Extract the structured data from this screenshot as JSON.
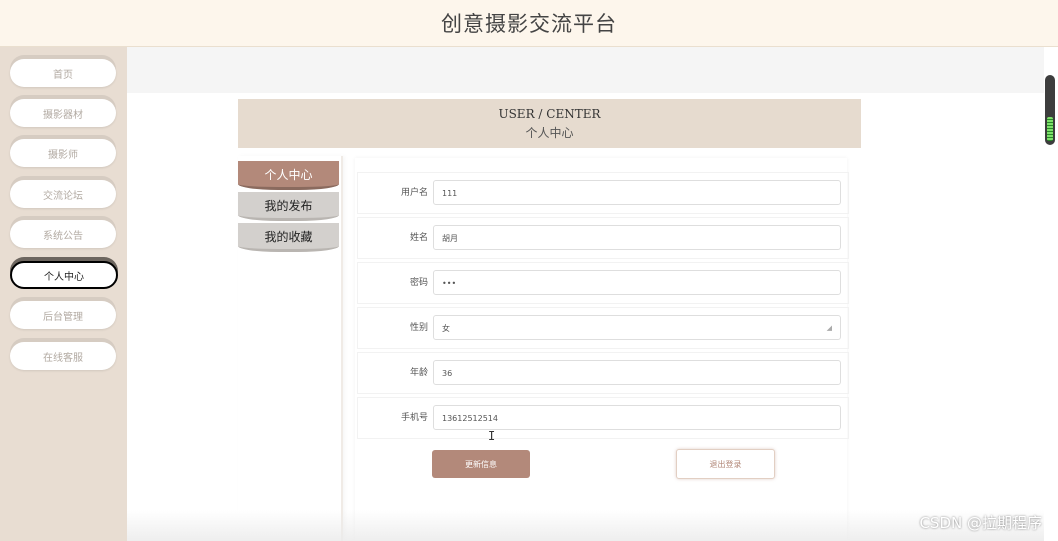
{
  "app_title": "创意摄影交流平台",
  "sidebar": {
    "items": [
      {
        "label": "首页"
      },
      {
        "label": "摄影器材"
      },
      {
        "label": "摄影师"
      },
      {
        "label": "交流论坛"
      },
      {
        "label": "系统公告"
      },
      {
        "label": "个人中心",
        "active": true
      },
      {
        "label": "后台管理"
      },
      {
        "label": "在线客服"
      }
    ]
  },
  "banner": {
    "en": "USER / CENTER",
    "cn": "个人中心"
  },
  "tabs": [
    {
      "label": "个人中心",
      "active": true
    },
    {
      "label": "我的发布"
    },
    {
      "label": "我的收藏"
    }
  ],
  "form": {
    "username": {
      "label": "用户名",
      "value": "111"
    },
    "name": {
      "label": "姓名",
      "value": "胡月"
    },
    "password": {
      "label": "密码",
      "value": "•••"
    },
    "gender": {
      "label": "性别",
      "value": "女"
    },
    "age": {
      "label": "年龄",
      "value": "36"
    },
    "phone": {
      "label": "手机号",
      "value": "13612512514"
    }
  },
  "buttons": {
    "update": "更新信息",
    "logout": "退出登录"
  },
  "watermark": "CSDN @拉期程序",
  "colors": {
    "accent": "#b3897a",
    "header_bg": "#fdf6ec",
    "sidebar_bg": "#e8ddd2",
    "banner_bg": "#e6dbcf"
  }
}
